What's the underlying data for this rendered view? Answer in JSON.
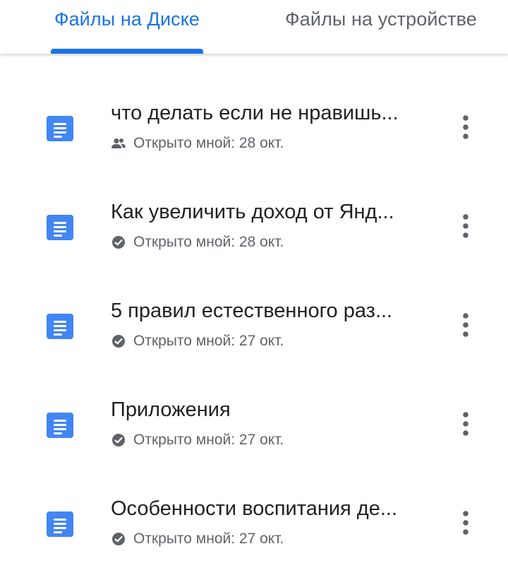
{
  "tabs": [
    {
      "label": "Файлы на Диске",
      "active": true
    },
    {
      "label": "Файлы на устройстве",
      "active": false
    }
  ],
  "colors": {
    "accent": "#1a73e8",
    "doc_icon": "#4285f4",
    "title_text": "#202124",
    "secondary_text": "#5f6368"
  },
  "files": [
    {
      "title": "что делать если не нравишь...",
      "meta": "Открыто мной: 28 окт.",
      "meta_icon": "shared-people-icon",
      "file_icon": "google-docs-icon"
    },
    {
      "title": "Как увеличить доход от Янд...",
      "meta": "Открыто мной: 28 окт.",
      "meta_icon": "check-circle-icon",
      "file_icon": "google-docs-icon"
    },
    {
      "title": "5 правил естественного раз...",
      "meta": "Открыто мной: 27 окт.",
      "meta_icon": "check-circle-icon",
      "file_icon": "google-docs-icon"
    },
    {
      "title": "Приложения",
      "meta": "Открыто мной: 27 окт.",
      "meta_icon": "check-circle-icon",
      "file_icon": "google-docs-icon"
    },
    {
      "title": "Особенности воспитания де...",
      "meta": "Открыто мной: 27 окт.",
      "meta_icon": "check-circle-icon",
      "file_icon": "google-docs-icon"
    }
  ]
}
